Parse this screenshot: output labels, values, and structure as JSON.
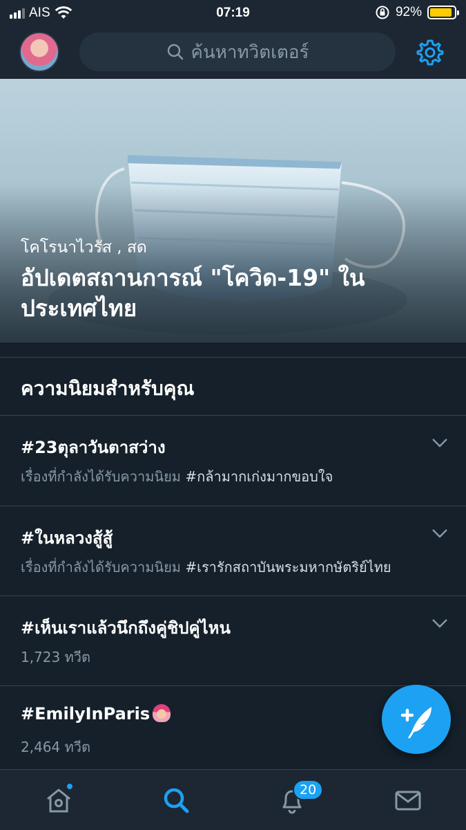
{
  "status_bar": {
    "carrier": "AIS",
    "time": "07:19",
    "battery_percent": "92%",
    "battery_level": 0.92,
    "battery_color": "#ffcc00"
  },
  "header": {
    "search_placeholder": "ค้นหาทวิตเตอร์"
  },
  "hero": {
    "kicker": "โคโรนาไวรัส , สด",
    "title": "อัปเดตสถานการณ์ \"โควิด-19\" ในประเทศไทย"
  },
  "section": {
    "title": "ความนิยมสำหรับคุณ"
  },
  "trends": [
    {
      "name": "#23ตุลาวันตาสว่าง",
      "meta_prefix": "เรื่องที่กำลังได้รับความนิยม",
      "meta_tag": "#กล้ามากเก่งมากขอบใจ"
    },
    {
      "name": "#ในหลวงสู้สู้",
      "meta_prefix": "เรื่องที่กำลังได้รับความนิยม",
      "meta_tag": "#เรารักสถาบันพระมหากษัตริย์ไทย"
    },
    {
      "name": "#เห็นเราแล้วนึกถึงคู่ชิปคู่ไหน",
      "meta_prefix": "1,723 ทวีต",
      "meta_tag": ""
    },
    {
      "name": "#EmilyInParis",
      "meta_prefix": "2,464 ทวีต",
      "meta_tag": ""
    }
  ],
  "tabbar": {
    "notifications_count": "20",
    "items": [
      "home-icon",
      "search-icon",
      "bell-icon",
      "mail-icon"
    ]
  },
  "colors": {
    "background": "#15202b",
    "bar": "#1c2733",
    "accent": "#1da1f2",
    "secondary_text": "#8899a6",
    "divider": "#38444d"
  }
}
